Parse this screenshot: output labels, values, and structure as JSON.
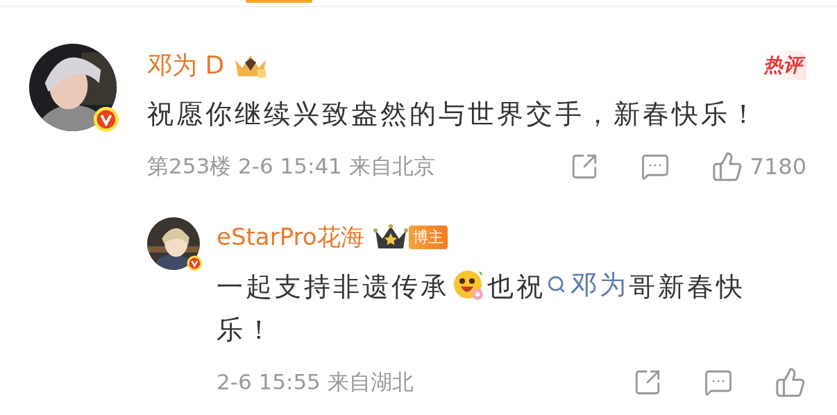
{
  "comments": [
    {
      "user": "邓为 D",
      "hot_label": "热评",
      "text": "祝愿你继续兴致盎然的与世界交手，新春快乐！",
      "meta": "第253楼 2-6 15:41 来自北京",
      "likes": "7180",
      "replies": [
        {
          "user": "eStarPro花海",
          "badge": "博主",
          "segments": [
            {
              "kind": "text",
              "text": "一起支持非遗传承"
            },
            {
              "kind": "emoji"
            },
            {
              "kind": "text",
              "text": "也祝"
            },
            {
              "kind": "mention",
              "text": "邓为"
            },
            {
              "kind": "text",
              "text": "哥新春快乐！"
            }
          ],
          "meta": "2-6 15:55 来自湖北"
        }
      ]
    }
  ]
}
